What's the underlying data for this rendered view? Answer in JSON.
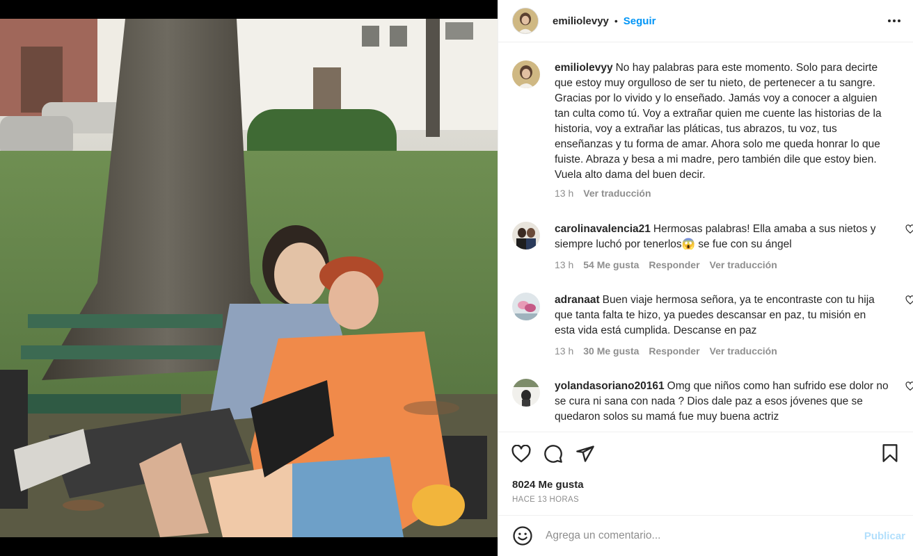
{
  "post": {
    "username": "emiliolevyy",
    "follow_label": "Seguir",
    "dot": "•",
    "caption_user": "emiliolevyy",
    "caption_text": "No hay palabras para este momento. Solo para decirte que estoy muy orgulloso de ser tu nieto, de pertenecer a tu sangre. Gracias por lo vivido y lo enseñado. Jamás voy a conocer a alguien tan culta como tú. Voy a extrañar quien me cuente las historias de la historia, voy a extrañar las pláticas, tus abrazos, tu voz, tus enseñanzas y tu forma de amar. Ahora solo me queda honrar lo que fuiste. Abraza y besa a mi madre, pero también dile que estoy bien. Vuela alto dama del buen decir.",
    "caption_time": "13 h",
    "caption_translate": "Ver traducción"
  },
  "comments": [
    {
      "user": "carolinavalencia21",
      "text": "Hermosas palabras! Ella amaba a sus nietos y siempre luchó por tenerlos😱 se fue con su ángel",
      "time": "13 h",
      "likes": "54 Me gusta",
      "reply": "Responder",
      "translate": "Ver traducción"
    },
    {
      "user": "adranaat",
      "text": "Buen viaje hermosa señora, ya te encontraste con tu hija que tanta falta te hizo, ya puedes descansar en paz, tu misión en esta vida está cumplida. Descanse en paz",
      "time": "13 h",
      "likes": "30 Me gusta",
      "reply": "Responder",
      "translate": "Ver traducción"
    },
    {
      "user": "yolandasoriano20161",
      "text": "Omg que niños como han sufrido ese dolor no se cura ni sana con nada ? Dios dale paz a esos jóvenes que se quedaron solos su mamá fue muy buena actriz"
    }
  ],
  "actions": {
    "likes": "8024 Me gusta",
    "timestamp": "HACE 13 HORAS"
  },
  "add_comment": {
    "placeholder": "Agrega un comentario...",
    "publish_label": "Publicar"
  },
  "colors": {
    "link_blue": "#0095f6",
    "publish_disabled": "#b2dffc",
    "muted": "#8e8e8e",
    "text": "#262626"
  },
  "icons": [
    "more-options-icon",
    "heart-icon",
    "comment-icon",
    "share-icon",
    "bookmark-icon",
    "emoji-icon"
  ]
}
